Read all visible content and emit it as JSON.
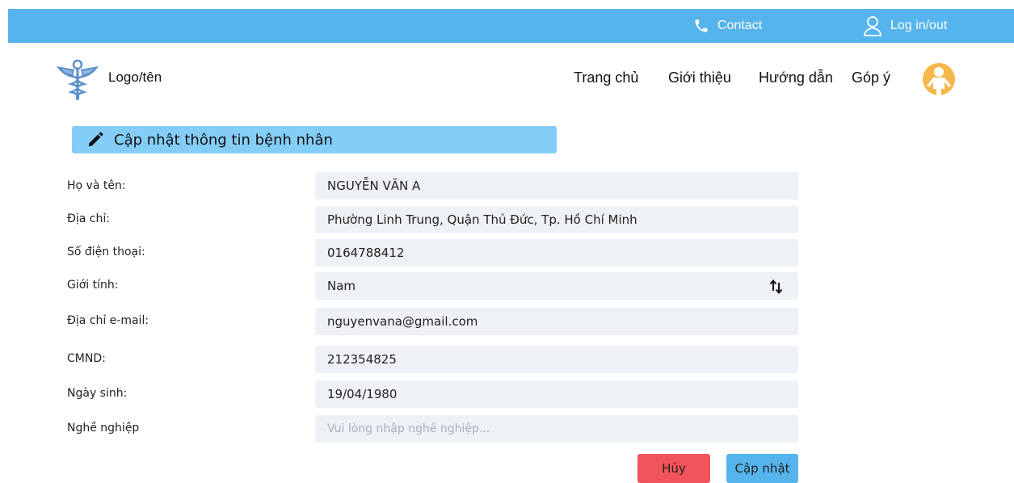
{
  "topbar": {
    "contact_label": "Contact",
    "contact_icon": "phone-icon",
    "login_label": "Log in/out",
    "login_icon": "user-icon",
    "background": "#55b4ec"
  },
  "header": {
    "logo_icon": "caduceus-icon",
    "logo_text": "Logo/tên",
    "nav": [
      {
        "label": "Trang chủ"
      },
      {
        "label": "Giới thiệu"
      },
      {
        "label": "Hướng dẫn"
      },
      {
        "label": "Góp ý"
      }
    ],
    "avatar_icon": "user-avatar-icon"
  },
  "form": {
    "title": "Cập nhật thông tin bệnh nhân",
    "title_icon": "pencil-icon",
    "fields": [
      {
        "label": "Họ và tên:",
        "value": "NGUYỄN VĂN A"
      },
      {
        "label": "Địa chỉ:",
        "value": "Phường Linh Trung, Quận Thủ Đức, Tp. Hồ Chí Minh"
      },
      {
        "label": "Số điện thoại:",
        "value": "0164788412"
      },
      {
        "label": "Giới tính:",
        "value": "Nam"
      },
      {
        "label": "Địa chỉ e-mail:",
        "value": "nguyenvana@gmail.com"
      },
      {
        "label": "CMND:",
        "value": "212354825"
      },
      {
        "label": "Ngày sinh:",
        "value": "19/04/1980"
      },
      {
        "label": "Nghề nghiệp",
        "value": "",
        "placeholder": "Vui lòng nhập nghề nghiệp..."
      }
    ],
    "cancel_label": "Hủy",
    "update_label": "Cập nhật"
  },
  "colors": {
    "accent": "#55b4ec",
    "title_bar": "#84cdf6",
    "cancel": "#f2545b",
    "avatar": "#f6b84b",
    "field_bg": "#eef1f5"
  }
}
